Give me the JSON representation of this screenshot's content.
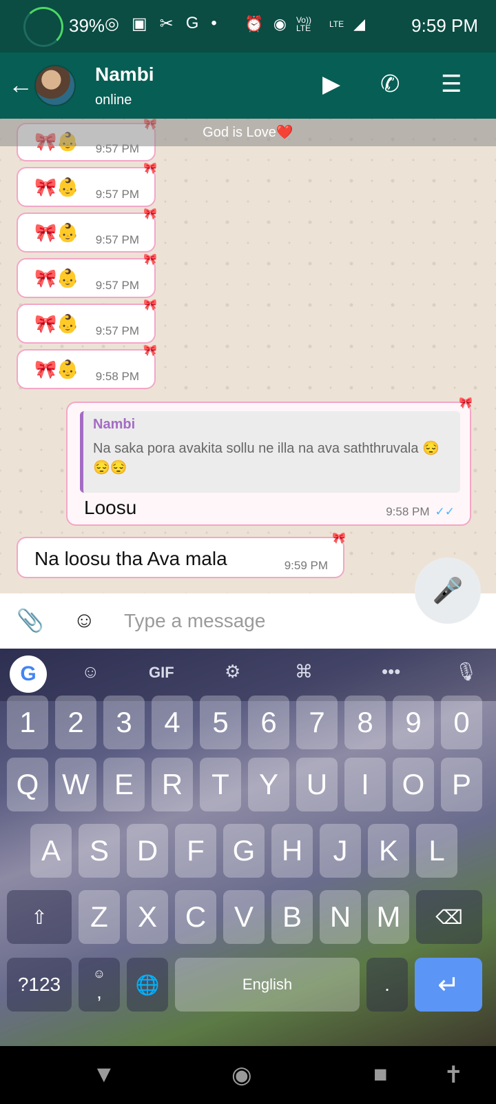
{
  "status_bar": {
    "battery": "39%",
    "time": "9:59 PM",
    "left_icons": [
      "whatsapp-icon",
      "instagram-icon",
      "tools-icon",
      "google-icon",
      "dot-icon"
    ],
    "right_icons": [
      "alarm-icon",
      "hotspot-icon",
      "volte-icon",
      "signal-icon"
    ],
    "volte_label": "Vo)) LTE",
    "lte_label": "LTE",
    "g_letter": "G"
  },
  "header": {
    "contact_name": "Nambi",
    "contact_status": "online",
    "icons": [
      "back-arrow-icon",
      "video-call-icon",
      "phone-icon",
      "menu-icon"
    ]
  },
  "chat": {
    "banner": "God is Love❤️",
    "incoming": [
      {
        "text": "🎀👶",
        "time": "9:57 PM"
      },
      {
        "text": "🎀👶",
        "time": "9:57 PM"
      },
      {
        "text": "🎀👶",
        "time": "9:57 PM"
      },
      {
        "text": "🎀👶",
        "time": "9:57 PM"
      },
      {
        "text": "🎀👶",
        "time": "9:57 PM"
      },
      {
        "text": "🎀👶",
        "time": "9:58 PM"
      }
    ],
    "outgoing": {
      "quote_author": "Nambi",
      "quote_text": "Na saka pora avakita sollu ne illa na ava saththruvala 😔😔😔",
      "text": "Loosu",
      "time": "9:58 PM",
      "ticks": "✓✓"
    },
    "last_incoming": {
      "text": "Na loosu tha Ava mala",
      "time": "9:59 PM"
    }
  },
  "input": {
    "placeholder": "Type a message",
    "icons": [
      "attach-icon",
      "emoji-icon",
      "mic-icon"
    ]
  },
  "keyboard": {
    "toolbar": {
      "g": "G",
      "gif": "GIF",
      "more": "•••"
    },
    "row_numbers": [
      "1",
      "2",
      "3",
      "4",
      "5",
      "6",
      "7",
      "8",
      "9",
      "0"
    ],
    "row_q": [
      "Q",
      "W",
      "E",
      "R",
      "T",
      "Y",
      "U",
      "I",
      "O",
      "P"
    ],
    "row_a": [
      "A",
      "S",
      "D",
      "F",
      "G",
      "H",
      "J",
      "K",
      "L"
    ],
    "row_z": [
      "Z",
      "X",
      "C",
      "V",
      "B",
      "N",
      "M"
    ],
    "symbols_label": "?123",
    "comma_label": ",",
    "space_label": "English",
    "period_label": ".",
    "enter_icon": "enter-icon"
  },
  "nav_bar": {
    "icons": [
      "back-triangle-icon",
      "home-circle-icon",
      "recents-square-icon",
      "accessibility-icon"
    ]
  },
  "colors": {
    "header": "#075e54",
    "status_bar": "#0b4c43",
    "bubble_border": "#f3a6c6",
    "enter_key": "#5b95f5"
  }
}
